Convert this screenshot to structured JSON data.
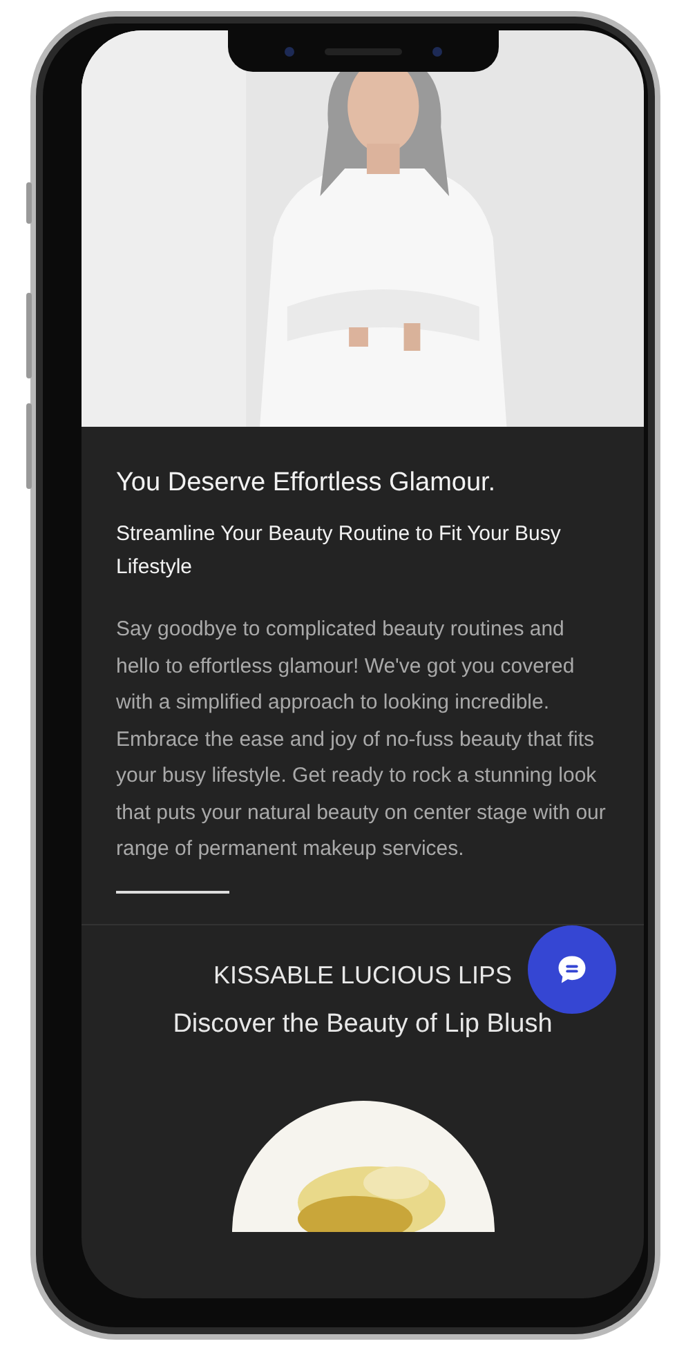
{
  "intro": {
    "title": "You Deserve Effortless Glamour.",
    "subtitle": "Streamline Your Beauty Routine to Fit Your Busy Lifestyle",
    "body": "Say goodbye to complicated beauty routines and hello to effortless glamour! We've got you covered with a simplified approach to looking incredible. Embrace the ease and joy of no-fuss beauty that fits your busy lifestyle. Get ready to rock a stunning look that puts your natural beauty on center stage with our range of permanent makeup services."
  },
  "feature": {
    "heading": "KISSABLE LUCIOUS LIPS",
    "subheading": "Discover the Beauty of Lip Blush"
  }
}
